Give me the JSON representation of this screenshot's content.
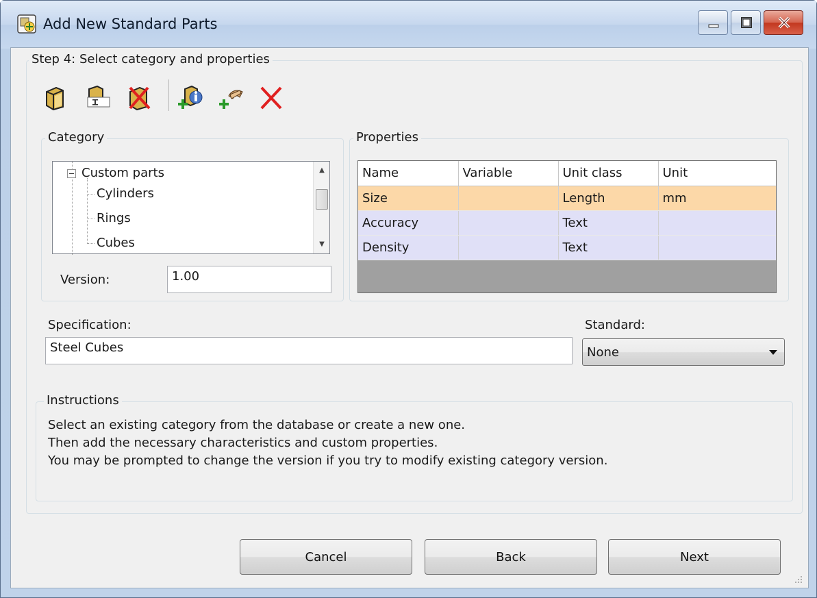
{
  "window": {
    "title": "Add New Standard Parts"
  },
  "step": {
    "title": "Step 4: Select category and properties"
  },
  "toolbar": {
    "icons": [
      "new-category-icon",
      "rename-category-icon",
      "delete-category-icon",
      "add-property-icon",
      "add-custom-property-icon",
      "delete-property-icon"
    ]
  },
  "category": {
    "legend": "Category",
    "tree": {
      "root": "Custom parts",
      "children": [
        "Cylinders",
        "Rings",
        "Cubes"
      ]
    },
    "version_label": "Version:",
    "version_value": "1.00"
  },
  "properties": {
    "legend": "Properties",
    "columns": [
      "Name",
      "Variable",
      "Unit class",
      "Unit"
    ],
    "rows": [
      {
        "name": "Size",
        "variable": "",
        "unit_class": "Length",
        "unit": "mm"
      },
      {
        "name": "Accuracy",
        "variable": "",
        "unit_class": "Text",
        "unit": ""
      },
      {
        "name": "Density",
        "variable": "",
        "unit_class": "Text",
        "unit": ""
      }
    ]
  },
  "specification": {
    "label": "Specification:",
    "value": "Steel Cubes"
  },
  "standard": {
    "label": "Standard:",
    "selected": "None"
  },
  "instructions": {
    "legend": "Instructions",
    "lines": [
      "Select an existing category from the database or create a new one.",
      "Then add the necessary characteristics and custom properties.",
      "You may be prompted to change the version if you try to modify existing category version."
    ]
  },
  "buttons": {
    "cancel": "Cancel",
    "back": "Back",
    "next": "Next"
  },
  "colors": {
    "selected_row": "#fcd8a8",
    "row": "#e0e0f7",
    "delete_red": "#e02020"
  }
}
